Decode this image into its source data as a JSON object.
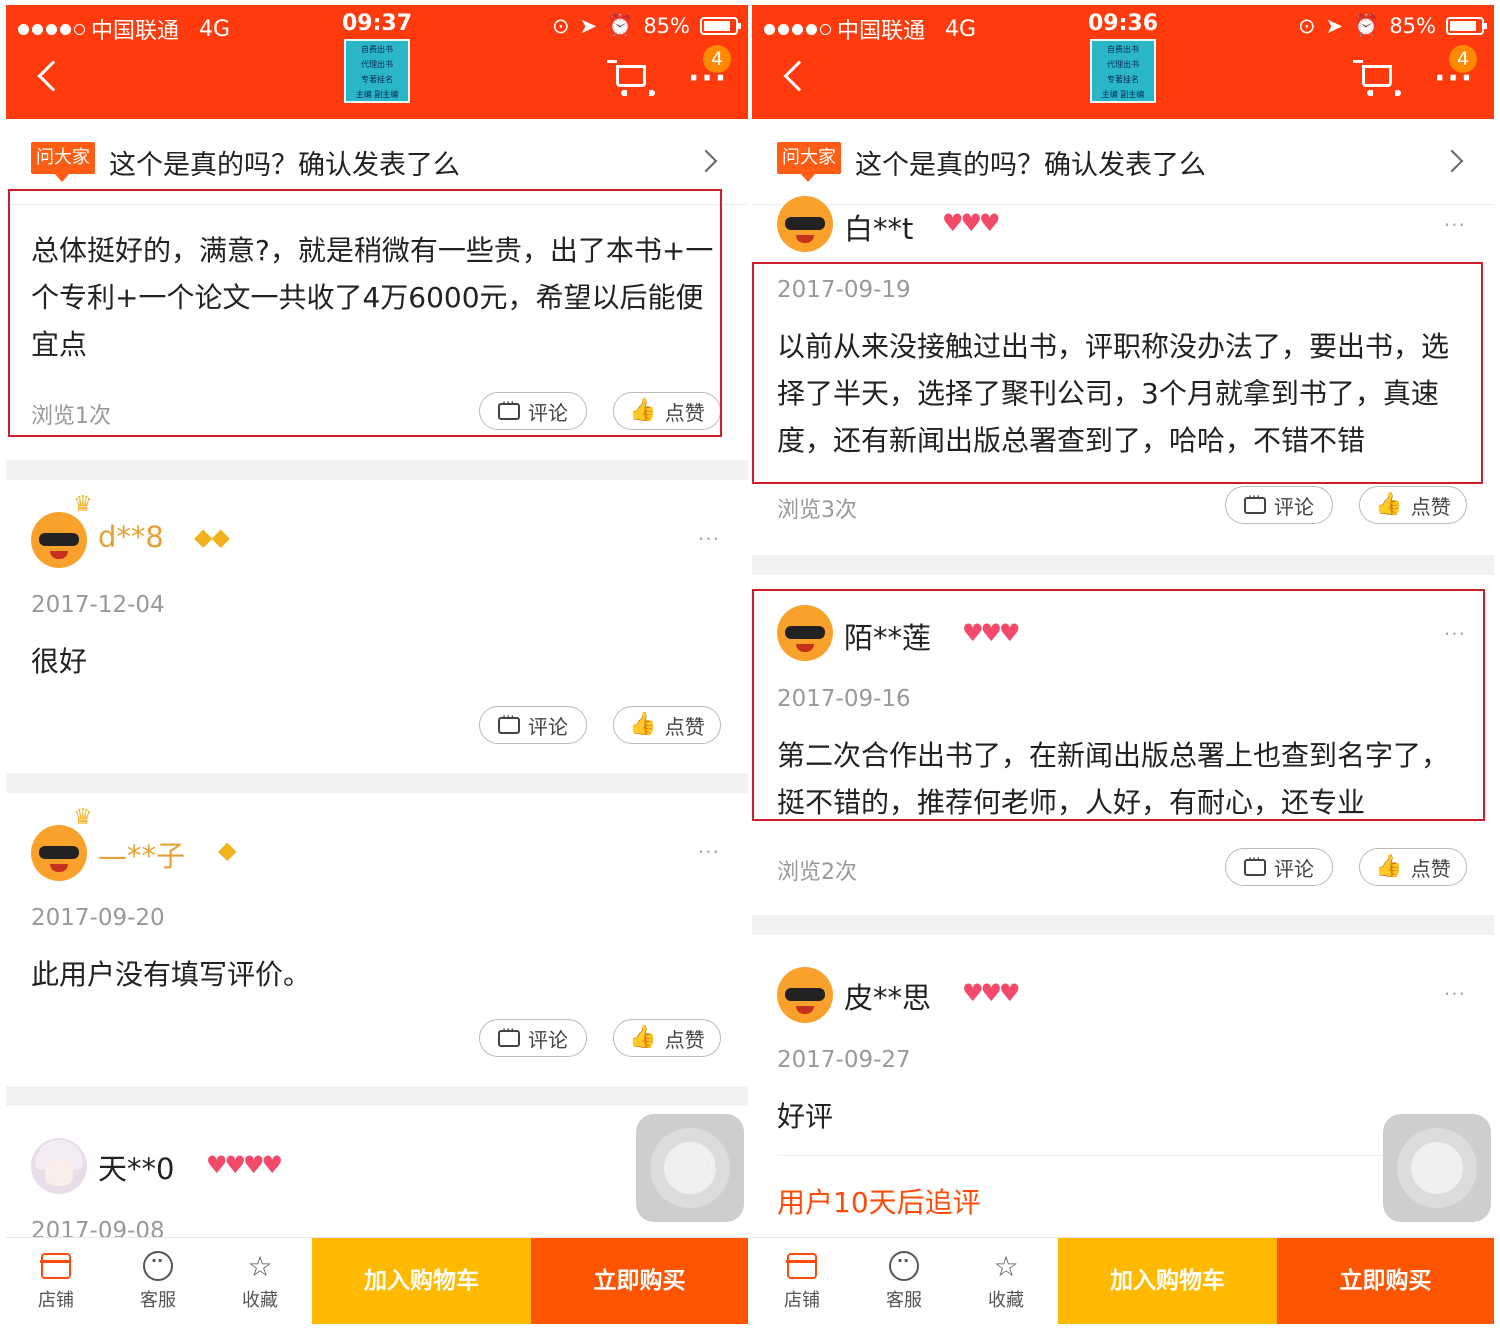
{
  "colors": {
    "brand": "#ff3a0d",
    "highlight_border": "#cc1f2a",
    "cart_cta": "#ffba00",
    "buy_cta": "#ff5500"
  },
  "left": {
    "status": {
      "carrier": "中国联通",
      "network": "4G",
      "time": "09:37",
      "battery": "85%"
    },
    "header": {
      "logo_lines": [
        "自费出书",
        "代理出书",
        "专著挂名",
        "主编 副主编"
      ],
      "badge": "4"
    },
    "ask": {
      "tag": "问大家",
      "question": "这个是真的吗？确认发表了么"
    },
    "reviews": [
      {
        "content": "总体挺好的，满意?，就是稍微有一些贵，出了本书+一个专利+一个论文一共收了4万6000元，希望以后能便宜点",
        "views": "浏览1次",
        "comment": "评论",
        "like": "点赞"
      },
      {
        "user": "d**8",
        "levels": "◆◆",
        "date": "2017-12-04",
        "content": "很好",
        "comment": "评论",
        "like": "点赞"
      },
      {
        "user": "—**子",
        "levels": "◆",
        "date": "2017-09-20",
        "content": "此用户没有填写评价。",
        "comment": "评论",
        "like": "点赞"
      },
      {
        "user": "天**0",
        "levels": "♥♥♥♥",
        "date": "2017-09-08"
      }
    ],
    "bottom": {
      "shop": "店铺",
      "service": "客服",
      "favorite": "收藏",
      "add_cart": "加入购物车",
      "buy_now": "立即购买"
    }
  },
  "right": {
    "status": {
      "carrier": "中国联通",
      "network": "4G",
      "time": "09:36",
      "battery": "85%"
    },
    "header": {
      "logo_lines": [
        "自费出书",
        "代理出书",
        "专著挂名",
        "主编 副主编"
      ],
      "badge": "4"
    },
    "ask": {
      "tag": "问大家",
      "question": "这个是真的吗？确认发表了么"
    },
    "reviews": [
      {
        "user": "白**t",
        "levels": "♥♥♥",
        "date": "2017-09-19",
        "content": "以前从来没接触过出书，评职称没办法了，要出书，选择了半天，选择了聚刊公司，3个月就拿到书了，真速度，还有新闻出版总署查到了，哈哈，不错不错",
        "views": "浏览3次",
        "comment": "评论",
        "like": "点赞"
      },
      {
        "user": "陌**莲",
        "levels": "♥♥♥",
        "date": "2017-09-16",
        "content": "第二次合作出书了，在新闻出版总署上也查到名字了，挺不错的，推荐何老师，人好，有耐心，还专业",
        "views": "浏览2次",
        "comment": "评论",
        "like": "点赞"
      },
      {
        "user": "皮**思",
        "levels": "♥♥♥",
        "date": "2017-09-27",
        "content": "好评",
        "follow_up": "用户10天后追评"
      }
    ],
    "bottom": {
      "shop": "店铺",
      "service": "客服",
      "favorite": "收藏",
      "add_cart": "加入购物车",
      "buy_now": "立即购买"
    }
  }
}
